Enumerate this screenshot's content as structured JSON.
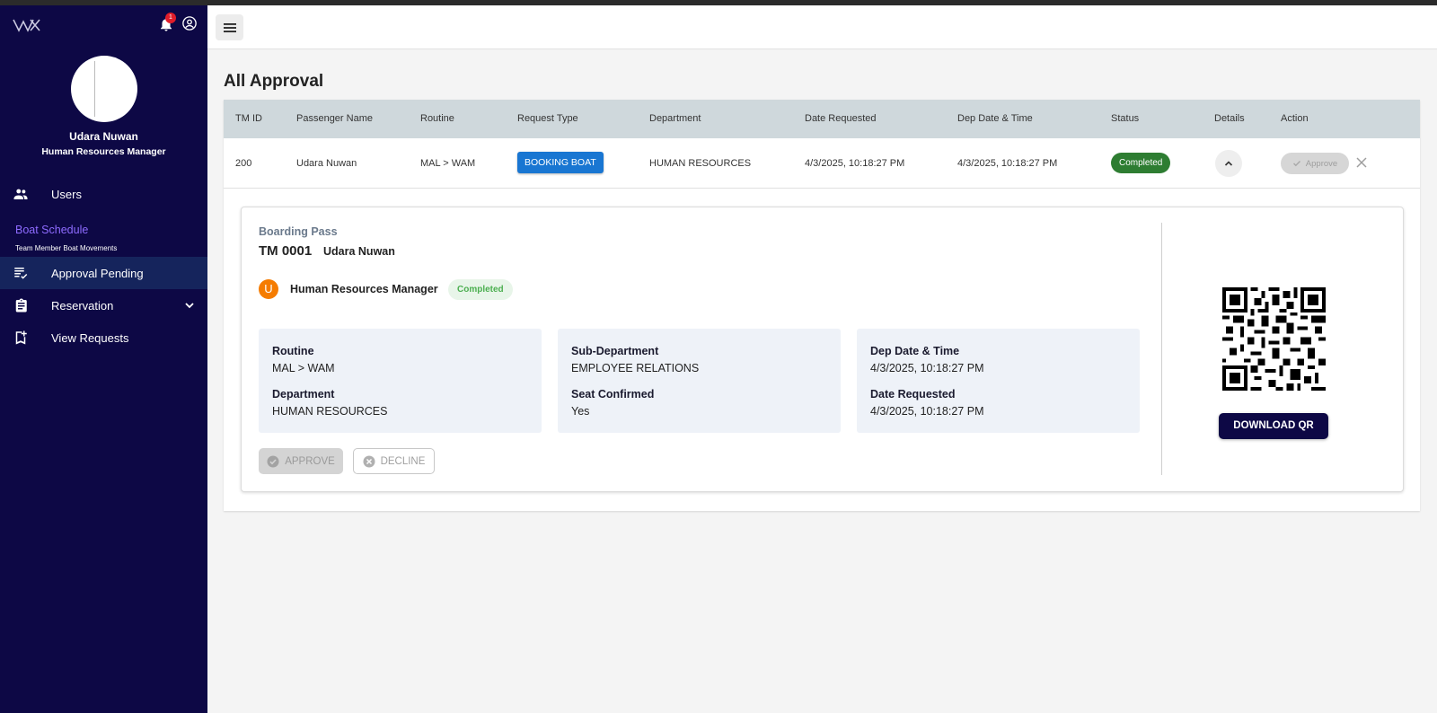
{
  "sidebar": {
    "user_name": "Udara Nuwan",
    "user_role": "Human Resources Manager",
    "notification_count": "1",
    "items": [
      {
        "label": "Users"
      },
      {
        "label": "Approval Pending"
      },
      {
        "label": "Reservation"
      },
      {
        "label": "View Requests"
      }
    ],
    "section_link": "Boat Schedule",
    "section_sub": "Team Member Boat Movements"
  },
  "main": {
    "title": "All Approval",
    "columns": [
      "TM ID",
      "Passenger Name",
      "Routine",
      "Request Type",
      "Department",
      "Date Requested",
      "Dep Date & Time",
      "Status",
      "Details",
      "Action"
    ],
    "row": {
      "tm_id": "200",
      "passenger": "Udara Nuwan",
      "routine": "MAL > WAM",
      "request_type": "BOOKING BOAT",
      "department": "HUMAN RESOURCES",
      "date_requested": "4/3/2025, 10:18:27 PM",
      "dep_datetime": "4/3/2025, 10:18:27 PM",
      "status": "Completed",
      "action_label": "Approve"
    }
  },
  "boarding_pass": {
    "label": "Boarding Pass",
    "tm_number": "TM 0001",
    "name": "Udara Nuwan",
    "avatar_letter": "U",
    "role": "Human Resources Manager",
    "status": "Completed",
    "routine_label": "Routine",
    "routine_value": "MAL > WAM",
    "department_label": "Department",
    "department_value": "HUMAN RESOURCES",
    "subdept_label": "Sub-Department",
    "subdept_value": "EMPLOYEE RELATIONS",
    "seat_label": "Seat Confirmed",
    "seat_value": "Yes",
    "dep_label": "Dep Date & Time",
    "dep_value": "4/3/2025, 10:18:27 PM",
    "req_label": "Date Requested",
    "req_value": "4/3/2025, 10:18:27 PM",
    "approve_btn": "APPROVE",
    "decline_btn": "DECLINE",
    "download_btn": "DOWNLOAD QR"
  },
  "colors": {
    "sidebar_bg": "#0d0845",
    "active_item": "#15245c",
    "chip_blue": "#1976d2",
    "chip_green": "#2e7d32",
    "accent_purple": "#8e6bff"
  }
}
